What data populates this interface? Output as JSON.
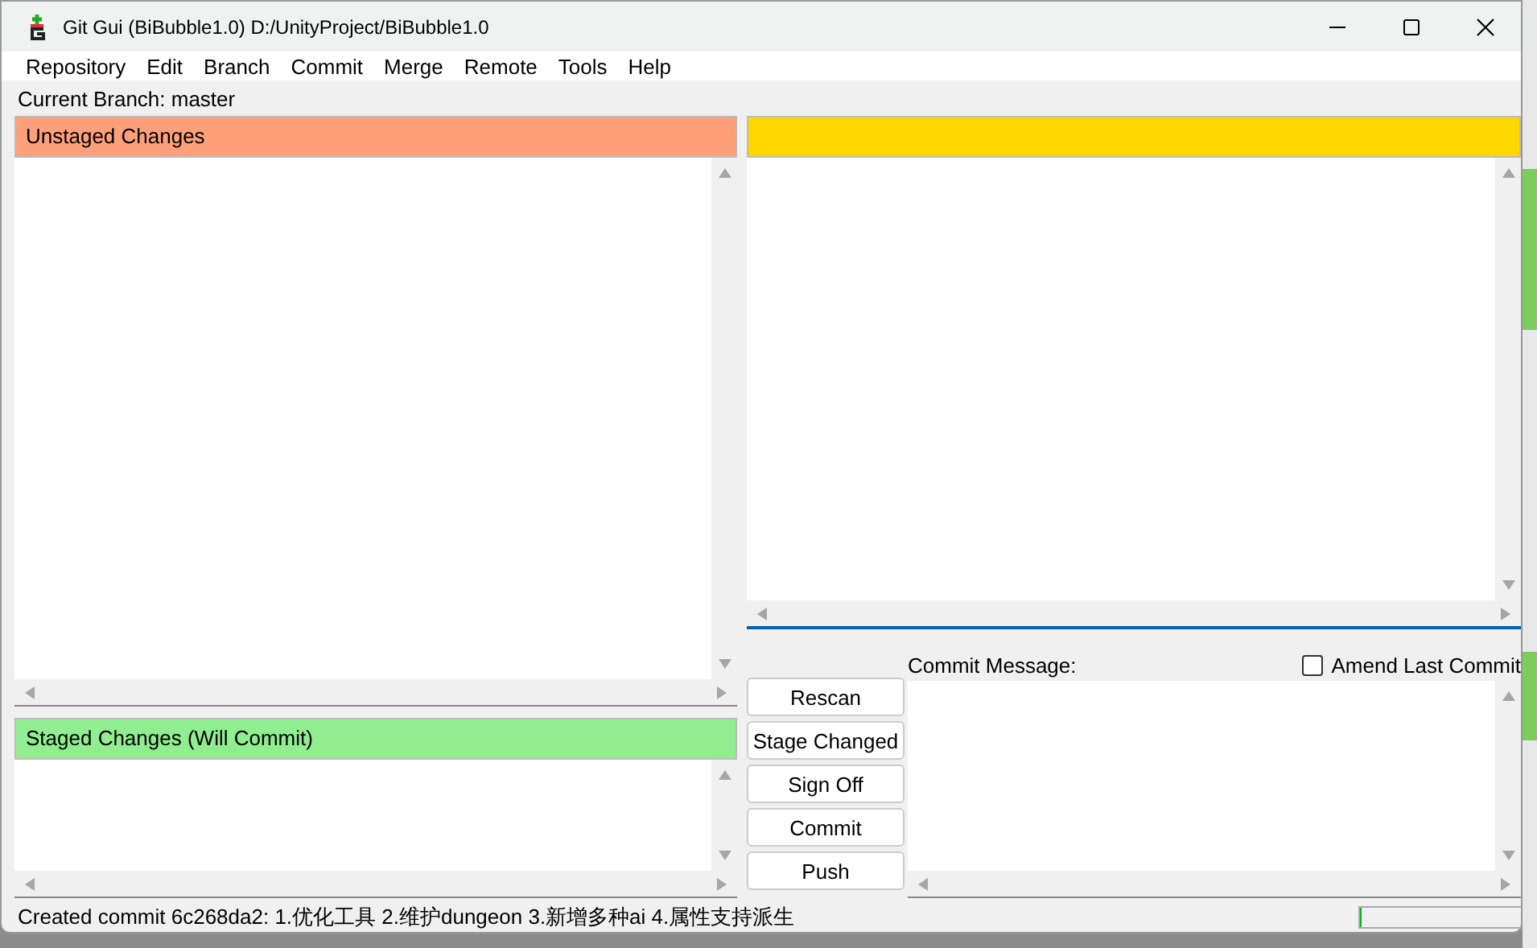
{
  "window": {
    "title": "Git Gui (BiBubble1.0) D:/UnityProject/BiBubble1.0"
  },
  "menu": [
    "Repository",
    "Edit",
    "Branch",
    "Commit",
    "Merge",
    "Remote",
    "Tools",
    "Help"
  ],
  "current_branch": "Current Branch: master",
  "unstaged": {
    "title": "Unstaged Changes"
  },
  "staged": {
    "title": "Staged Changes (Will Commit)"
  },
  "commit": {
    "label": "Commit Message:",
    "amend": {
      "label": "Amend Last Commit",
      "checked": false
    }
  },
  "buttons": [
    "Rescan",
    "Stage Changed",
    "Sign Off",
    "Commit",
    "Push"
  ],
  "progress": {
    "level": 0
  },
  "status_bar": "Created commit 6c268da2: 1.优化工具 2.维护dungeon 3.新增多种ai 4.属性支持派生"
}
